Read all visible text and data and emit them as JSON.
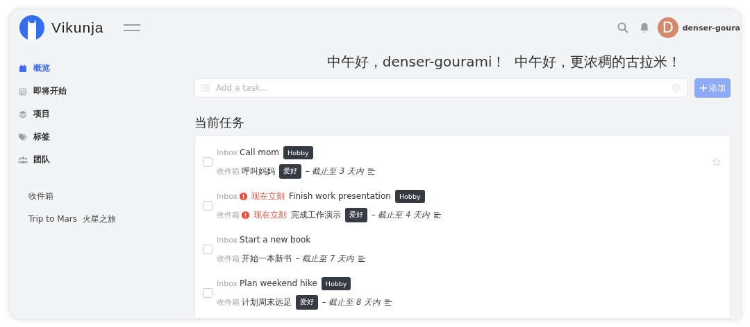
{
  "header": {
    "app_name": "Vikunja",
    "user": {
      "initial": "D",
      "name": "denser-goura"
    }
  },
  "sidebar": {
    "items": [
      {
        "label": "概览",
        "selected": true
      },
      {
        "label": "即将开始",
        "selected": false
      },
      {
        "label": "项目",
        "selected": false
      },
      {
        "label": "标签",
        "selected": false
      },
      {
        "label": "团队",
        "selected": false
      }
    ],
    "projects": [
      "收件箱",
      "Trip to Mars  火星之旅"
    ]
  },
  "greeting": "中午好，denser-gourami！  中午好，更浓稠的古拉米！",
  "add_task": {
    "placeholder": "Add a task...",
    "button": "添加"
  },
  "section_title": "当前任务",
  "tasks": [
    {
      "done": false,
      "hovered": true,
      "lines": [
        {
          "project": "Inbox",
          "title": "Call mom",
          "label": "Hobby"
        },
        {
          "project": "收件箱",
          "title": "呼叫妈妈",
          "label": "爱好",
          "due": "– 截止至 3 天内",
          "description": true
        }
      ]
    },
    {
      "done": false,
      "hovered": false,
      "lines": [
        {
          "project": "Inbox",
          "priority": "现在立刻",
          "title": "Finish work presentation",
          "label": "Hobby"
        },
        {
          "project": "收件箱",
          "priority": "现在立刻",
          "title": "完成工作演示",
          "label": "爱好",
          "due": "– 截止至 4 天内",
          "description": true
        }
      ]
    },
    {
      "done": false,
      "hovered": false,
      "lines": [
        {
          "project": "Inbox",
          "title": "Start a new book"
        },
        {
          "project": "收件箱",
          "title": "开始一本新书",
          "due": "– 截止至 7 天内",
          "description": true
        }
      ]
    },
    {
      "done": false,
      "hovered": false,
      "lines": [
        {
          "project": "Inbox",
          "title": "Plan weekend hike",
          "label": "Hobby"
        },
        {
          "project": "收件箱",
          "title": "计划周末远足",
          "label": "爱好",
          "due": "– 截止至 8 天内",
          "description": true
        }
      ]
    }
  ]
}
